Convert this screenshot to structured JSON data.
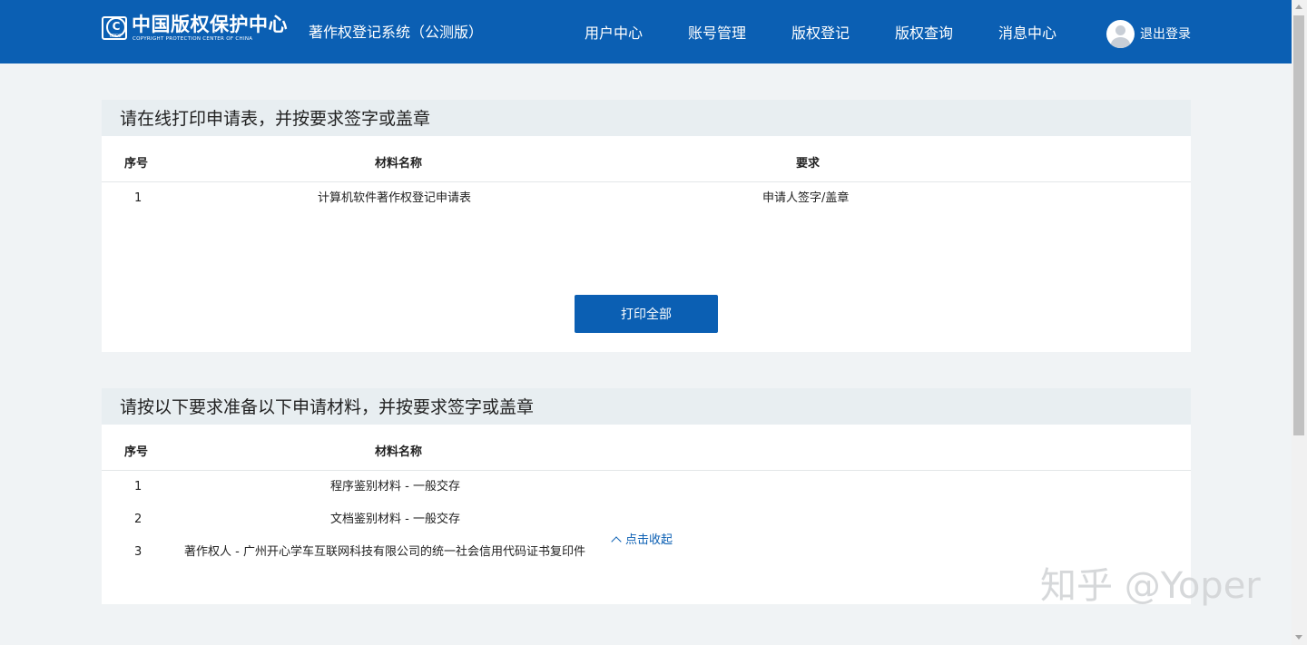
{
  "header": {
    "logo_cn": "中国版权保护中心",
    "logo_en": "COPYRIGHT PROTECTION CENTER OF CHINA",
    "logo_abbr": "CPCC",
    "system_title": "著作权登记系统（公测版）",
    "nav": [
      "用户中心",
      "账号管理",
      "版权登记",
      "版权查询",
      "消息中心"
    ],
    "logout_label": "退出登录"
  },
  "print_section": {
    "title": "请在线打印申请表，并按要求签字或盖章",
    "columns": [
      "序号",
      "材料名称",
      "要求"
    ],
    "rows": [
      {
        "no": "1",
        "name": "计算机软件著作权登记申请表",
        "requirement": "申请人签字/盖章"
      }
    ],
    "print_button_label": "打印全部"
  },
  "materials_section": {
    "title": "请按以下要求准备以下申请材料，并按要求签字或盖章",
    "columns": [
      "序号",
      "材料名称"
    ],
    "rows": [
      {
        "no": "1",
        "name": "程序鉴别材料 - 一般交存"
      },
      {
        "no": "2",
        "name": "文档鉴别材料 - 一般交存"
      },
      {
        "no": "3",
        "name": "著作权人 - 广州开心学车互联网科技有限公司的统一社会信用代码证书复印件"
      }
    ],
    "collapse_label": "点击收起"
  },
  "watermark": "知乎 @Yoper",
  "colors": {
    "brand_blue": "#0b5fb3",
    "page_bg": "#f0f3f5",
    "panel_header_bg": "#e8eef1"
  }
}
